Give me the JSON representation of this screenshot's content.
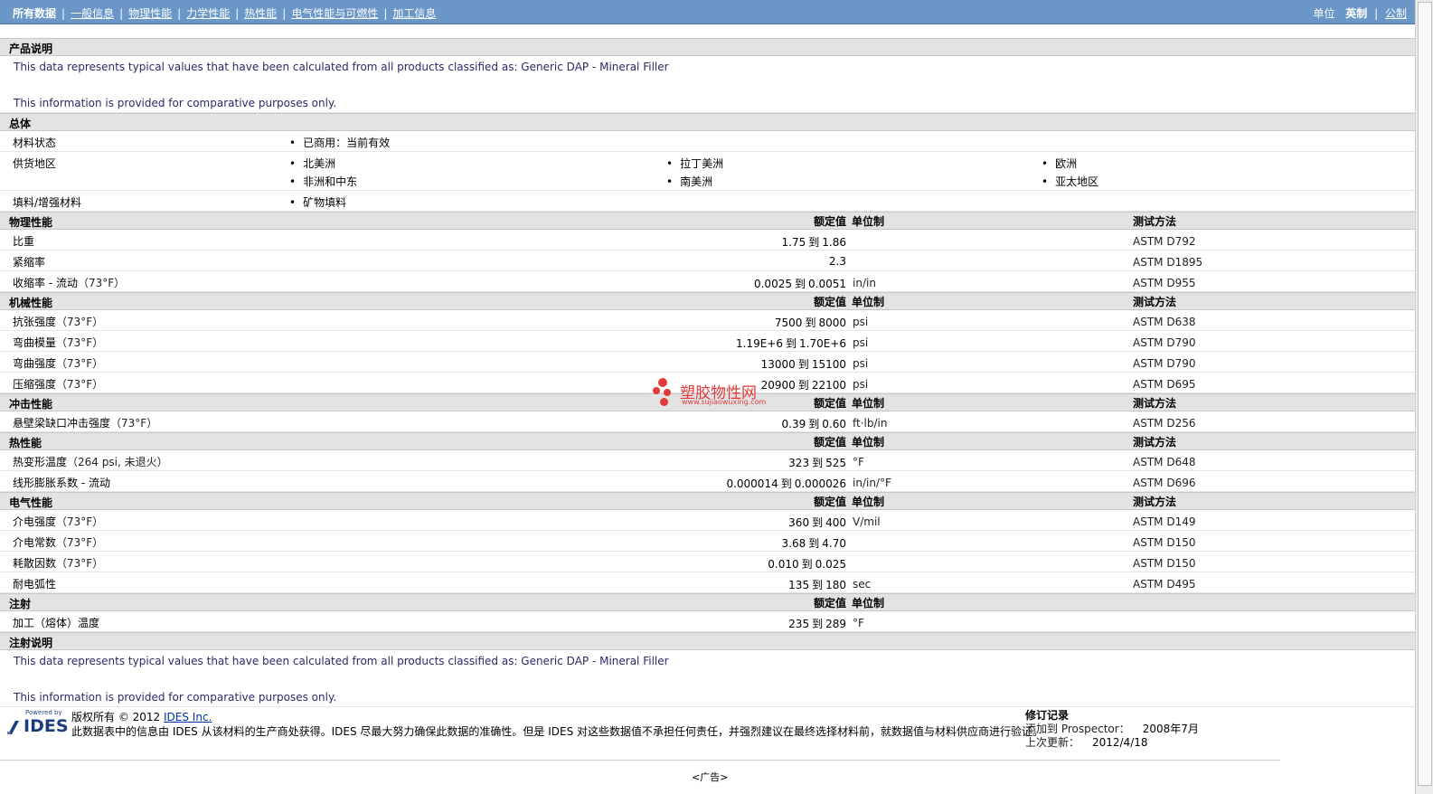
{
  "nav": {
    "items": [
      {
        "label": "所有数据",
        "current": true
      },
      {
        "label": "一般信息",
        "current": false
      },
      {
        "label": "物理性能",
        "current": false
      },
      {
        "label": "力学性能",
        "current": false
      },
      {
        "label": "热性能",
        "current": false
      },
      {
        "label": "电气性能与可燃性",
        "current": false
      },
      {
        "label": "加工信息",
        "current": false
      }
    ],
    "units_label": "单位",
    "units_english": "英制",
    "units_metric": "公制"
  },
  "product_desc": {
    "title": "产品说明",
    "line1": "This data represents typical values that have been calculated from all products classified as: Generic DAP - Mineral Filler",
    "line2": "This information is provided for comparative purposes only."
  },
  "general": {
    "title": "总体",
    "status_label": "材料状态",
    "status_value": "已商用：当前有效",
    "region_label": "供货地区",
    "regions": [
      "北美洲",
      "拉丁美洲",
      "欧洲",
      "非洲和中东",
      "南美洲",
      "亚太地区"
    ],
    "filler_label": "填料/增强材料",
    "filler_value": "矿物填料"
  },
  "col_headers": {
    "value": "额定值",
    "unit": "单位制",
    "method": "测试方法"
  },
  "range_word": "到",
  "sections": [
    {
      "title": "物理性能",
      "has_method": true,
      "rows": [
        {
          "name": "比重",
          "cond": "",
          "lo": "1.75",
          "hi": "1.86",
          "unit": "",
          "method": "ASTM D792"
        },
        {
          "name": "紧缩率",
          "cond": "",
          "lo": "",
          "hi": "2.3",
          "unit": "",
          "method": "ASTM D1895"
        },
        {
          "name": "收缩率 - 流动",
          "cond": "（73°F）",
          "lo": "0.0025",
          "hi": "0.0051",
          "unit": "in/in",
          "method": "ASTM D955"
        }
      ]
    },
    {
      "title": "机械性能",
      "has_method": true,
      "rows": [
        {
          "name": "抗张强度",
          "cond": "（73°F）",
          "lo": "7500",
          "hi": "8000",
          "unit": "psi",
          "method": "ASTM D638"
        },
        {
          "name": "弯曲模量",
          "cond": "（73°F）",
          "lo": "1.19E+6",
          "hi": "1.70E+6",
          "unit": "psi",
          "method": "ASTM D790"
        },
        {
          "name": "弯曲强度",
          "cond": "（73°F）",
          "lo": "13000",
          "hi": "15100",
          "unit": "psi",
          "method": "ASTM D790"
        },
        {
          "name": "压缩强度",
          "cond": "（73°F）",
          "lo": "20900",
          "hi": "22100",
          "unit": "psi",
          "method": "ASTM D695"
        }
      ]
    },
    {
      "title": "冲击性能",
      "has_method": true,
      "rows": [
        {
          "name": "悬壁梁缺口冲击强度",
          "cond": "（73°F）",
          "lo": "0.39",
          "hi": "0.60",
          "unit": "ft·lb/in",
          "method": "ASTM D256"
        }
      ]
    },
    {
      "title": "热性能",
      "has_method": true,
      "rows": [
        {
          "name": "热变形温度",
          "cond": "（264 psi, 未退火）",
          "lo": "323",
          "hi": "525",
          "unit": "°F",
          "method": "ASTM D648"
        },
        {
          "name": "线形膨胀系数 - 流动",
          "cond": "",
          "lo": "0.000014",
          "hi": "0.000026",
          "unit": "in/in/°F",
          "method": "ASTM D696"
        }
      ]
    },
    {
      "title": "电气性能",
      "has_method": true,
      "rows": [
        {
          "name": "介电强度",
          "cond": "（73°F）",
          "lo": "360",
          "hi": "400",
          "unit": "V/mil",
          "method": "ASTM D149"
        },
        {
          "name": "介电常数",
          "cond": "（73°F）",
          "lo": "3.68",
          "hi": "4.70",
          "unit": "",
          "method": "ASTM D150"
        },
        {
          "name": "耗散因数",
          "cond": "（73°F）",
          "lo": "0.010",
          "hi": "0.025",
          "unit": "",
          "method": "ASTM D150"
        },
        {
          "name": "耐电弧性",
          "cond": "",
          "lo": "135",
          "hi": "180",
          "unit": "sec",
          "method": "ASTM D495"
        }
      ]
    },
    {
      "title": "注射",
      "has_method": false,
      "rows": [
        {
          "name": "加工（熔体）温度",
          "cond": "",
          "lo": "235",
          "hi": "289",
          "unit": "°F",
          "method": ""
        }
      ]
    }
  ],
  "injection_desc": {
    "title": "注射说明",
    "line1": "This data represents typical values that have been calculated from all products classified as: Generic DAP - Mineral Filler",
    "line2": "This information is provided for comparative purposes only."
  },
  "watermark": {
    "name": "塑胶物性网",
    "url": "www.sujiaowuxing.com"
  },
  "footer": {
    "logo_powered": "Powered by",
    "logo_text": "IDES",
    "copyright_prefix": "版权所有 © 2012",
    "copyright_link": "IDES Inc.",
    "disclaimer": "此数据表中的信息由 IDES 从该材料的生产商处获得。IDES 尽最大努力确保此数据的准确性。但是 IDES 对这些数据值不承担任何责任，并强烈建议在最终选择材料前，就数据值与材料供应商进行验证。",
    "rev_title": "修订记录",
    "added_label": "添加到 Prospector：",
    "added_value": "2008年7月",
    "updated_label": "上次更新：",
    "updated_value": "2012/4/18",
    "ad": "<广告>"
  },
  "colors": {
    "nav_bg": "#6b96c8",
    "section_bg": "#e3e3e3",
    "watermark": "#e23a3a",
    "logo": "#1d3d7a"
  }
}
